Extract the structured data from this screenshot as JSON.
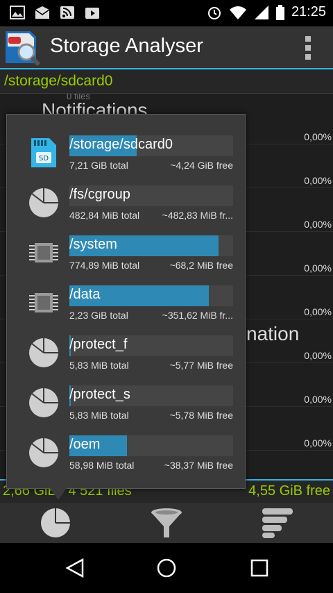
{
  "status_bar": {
    "time": "21:25",
    "left_icons": [
      "image-icon",
      "mail-icon",
      "rss-icon",
      "youtube-icon"
    ],
    "right_icons": [
      "alarm-icon",
      "wifi-icon",
      "signal-icon",
      "battery-icon"
    ]
  },
  "app_bar": {
    "title": "Storage Analyser",
    "logo_icon": "sd-magnifier-icon",
    "menu_icon": "overflow-menu-icon"
  },
  "path_bar": {
    "path": "/storage/sdcard0"
  },
  "background_list": {
    "partial_heading": "Notifications",
    "partial_subheading": "0 files",
    "partial_text": "nation",
    "percentages": [
      "0,00%",
      "0,00%",
      "0,00%",
      "0,00%",
      "0,00%",
      "0,00%",
      "0,00%",
      "0,00%"
    ]
  },
  "footer": {
    "left": "2,66 GiB / 4 521 files",
    "right": "4,55 GiB free"
  },
  "storage_popup": {
    "items": [
      {
        "name": "/storage/sdcard0",
        "total": "7,21 GiB total",
        "free": "~4,24 GiB free",
        "icon": "sd-card-icon",
        "used_fraction": 0.41
      },
      {
        "name": "/fs/cgroup",
        "total": "482,84 MiB total",
        "free": "~482,83 MiB fr...",
        "icon": "pie-chart-icon",
        "used_fraction": 0.0
      },
      {
        "name": "/system",
        "total": "774,89 MiB total",
        "free": "~68,2 MiB free",
        "icon": "chip-icon",
        "used_fraction": 0.91
      },
      {
        "name": "/data",
        "total": "2,23 GiB total",
        "free": "~351,62 MiB fr...",
        "icon": "chip-icon",
        "used_fraction": 0.85
      },
      {
        "name": "/protect_f",
        "total": "5,83 MiB total",
        "free": "~5,77 MiB free",
        "icon": "pie-chart-icon",
        "used_fraction": 0.01
      },
      {
        "name": "/protect_s",
        "total": "5,83 MiB total",
        "free": "~5,78 MiB free",
        "icon": "pie-chart-icon",
        "used_fraction": 0.01
      },
      {
        "name": "/oem",
        "total": "58,98 MiB total",
        "free": "~38,37 MiB free",
        "icon": "pie-chart-icon",
        "used_fraction": 0.35
      }
    ]
  },
  "toolbar": {
    "buttons": [
      {
        "icon": "pie-chart-icon"
      },
      {
        "icon": "filter-funnel-icon"
      },
      {
        "icon": "sort-bars-icon"
      }
    ]
  },
  "nav_bar": {
    "buttons": [
      {
        "icon": "back-triangle-icon"
      },
      {
        "icon": "home-circle-icon"
      },
      {
        "icon": "recents-square-icon"
      }
    ]
  },
  "colors": {
    "accent_blue": "#33b5e5",
    "bar_fill": "#2e8ab5",
    "text_green": "#99cc00"
  }
}
